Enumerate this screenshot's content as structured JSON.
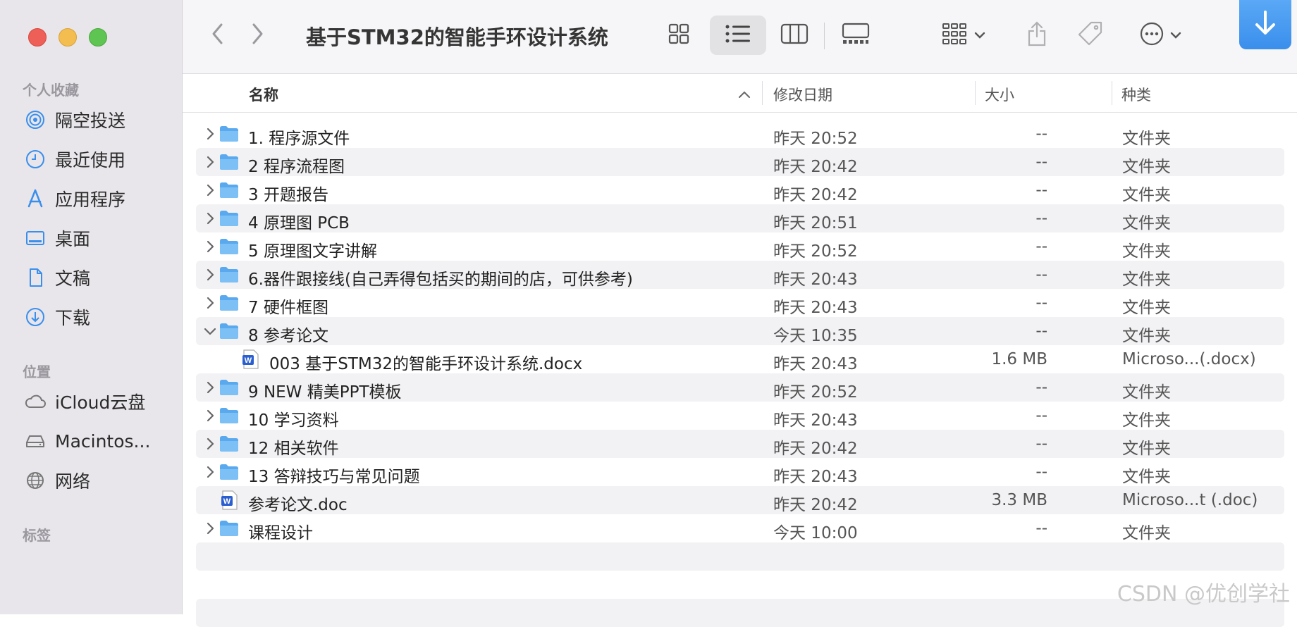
{
  "sidebar": {
    "favorites_header": "个人收藏",
    "favorites": [
      {
        "label": "隔空投送",
        "icon": "airdrop-icon"
      },
      {
        "label": "最近使用",
        "icon": "clock-icon"
      },
      {
        "label": "应用程序",
        "icon": "applications-icon"
      },
      {
        "label": "桌面",
        "icon": "desktop-icon"
      },
      {
        "label": "文稿",
        "icon": "document-icon"
      },
      {
        "label": "下载",
        "icon": "download-circle-icon"
      }
    ],
    "locations_header": "位置",
    "locations": [
      {
        "label": "iCloud云盘",
        "icon": "cloud-icon"
      },
      {
        "label": "Macintos...",
        "icon": "harddisk-icon"
      },
      {
        "label": "网络",
        "icon": "network-globe-icon"
      }
    ],
    "tags_header": "标签"
  },
  "toolbar": {
    "title": "基于STM32的智能手环设计系统"
  },
  "columns": {
    "name": "名称",
    "date": "修改日期",
    "size": "大小",
    "kind": "种类"
  },
  "files": [
    {
      "name": "1. 程序源文件",
      "date": "昨天 20:52",
      "size": "--",
      "kind": "文件夹",
      "type": "folder",
      "expanded": false
    },
    {
      "name": "2 程序流程图",
      "date": "昨天 20:42",
      "size": "--",
      "kind": "文件夹",
      "type": "folder",
      "expanded": false
    },
    {
      "name": "3 开题报告",
      "date": "昨天 20:42",
      "size": "--",
      "kind": "文件夹",
      "type": "folder",
      "expanded": false
    },
    {
      "name": "4 原理图 PCB",
      "date": "昨天 20:51",
      "size": "--",
      "kind": "文件夹",
      "type": "folder",
      "expanded": false
    },
    {
      "name": "5 原理图文字讲解",
      "date": "昨天 20:52",
      "size": "--",
      "kind": "文件夹",
      "type": "folder",
      "expanded": false
    },
    {
      "name": "6.器件跟接线(自己弄得包括买的期间的店，可供参考)",
      "date": "昨天 20:43",
      "size": "--",
      "kind": "文件夹",
      "type": "folder",
      "expanded": false
    },
    {
      "name": "7 硬件框图",
      "date": "昨天 20:43",
      "size": "--",
      "kind": "文件夹",
      "type": "folder",
      "expanded": false
    },
    {
      "name": "8 参考论文",
      "date": "今天 10:35",
      "size": "--",
      "kind": "文件夹",
      "type": "folder",
      "expanded": true
    },
    {
      "name": "003 基于STM32的智能手环设计系统.docx",
      "date": "昨天 20:43",
      "size": "1.6 MB",
      "kind": "Microso...(.docx)",
      "type": "word",
      "child": true
    },
    {
      "name": "9 NEW 精美PPT模板",
      "date": "昨天 20:52",
      "size": "--",
      "kind": "文件夹",
      "type": "folder",
      "expanded": false
    },
    {
      "name": "10 学习资料",
      "date": "昨天 20:43",
      "size": "--",
      "kind": "文件夹",
      "type": "folder",
      "expanded": false
    },
    {
      "name": "12 相关软件",
      "date": "昨天 20:42",
      "size": "--",
      "kind": "文件夹",
      "type": "folder",
      "expanded": false
    },
    {
      "name": "13 答辩技巧与常见问题",
      "date": "昨天 20:43",
      "size": "--",
      "kind": "文件夹",
      "type": "folder",
      "expanded": false
    },
    {
      "name": "参考论文.doc",
      "date": "昨天 20:42",
      "size": "3.3 MB",
      "kind": "Microso...t (.doc)",
      "type": "word"
    },
    {
      "name": "课程设计",
      "date": "今天 10:00",
      "size": "--",
      "kind": "文件夹",
      "type": "folder",
      "expanded": false
    }
  ],
  "watermark": "CSDN @优创学社",
  "colors": {
    "accent": "#3a8fec",
    "folder": "#6cb6f2",
    "sidebar_bg": "#e8e6ea"
  }
}
